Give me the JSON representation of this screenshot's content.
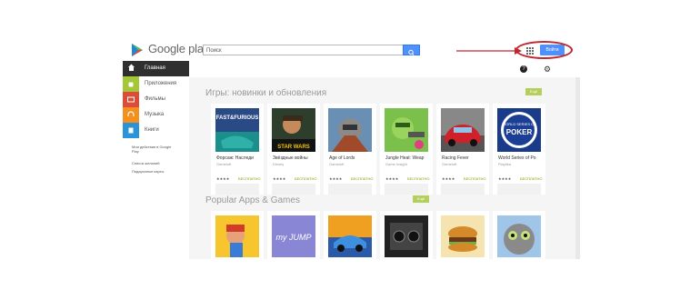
{
  "header": {
    "brand": "Google play",
    "search_placeholder": "Поиск",
    "signin_label": "Войти"
  },
  "sidebar": {
    "items": [
      {
        "label": "Главная",
        "color": "#2f2f2f",
        "icon": "home-icon",
        "active": true
      },
      {
        "label": "Приложения",
        "color": "#a4c739",
        "icon": "android-icon"
      },
      {
        "label": "Фильмы",
        "color": "#dd4b39",
        "icon": "film-icon"
      },
      {
        "label": "Музыка",
        "color": "#f4911e",
        "icon": "headphones-icon"
      },
      {
        "label": "Книги",
        "color": "#2b93d6",
        "icon": "book-icon"
      }
    ],
    "links": [
      "Мои действия в Google Play",
      "Список желаний",
      "Подарочные карты"
    ]
  },
  "sections": [
    {
      "title": "Игры: новинки и обновления",
      "more": "Ещё"
    },
    {
      "title": "Popular Apps & Games",
      "more": "Ещё"
    }
  ],
  "apps_row1": [
    {
      "name": "Форсаж: Наследи",
      "dev": "Gameloft",
      "rating": "★★★★",
      "price": "БЕСПЛАТНО"
    },
    {
      "name": "Звёздные войны",
      "dev": "Disney",
      "rating": "★★★★",
      "price": "БЕСПЛАТНО"
    },
    {
      "name": "Age of Lords",
      "dev": "Gameloft",
      "rating": "★★★★",
      "price": "БЕСПЛАТНО"
    },
    {
      "name": "Jungle Heat: Weap",
      "dev": "Game Insight",
      "rating": "★★★★",
      "price": "БЕСПЛАТНО"
    },
    {
      "name": "Racing Fever",
      "dev": "Gameloft",
      "rating": "★★★★",
      "price": "БЕСПЛАТНО"
    },
    {
      "name": "World Series of Po",
      "dev": "Playtika",
      "rating": "★★★★",
      "price": "БЕСПЛАТНО"
    }
  ],
  "thumb_text": {
    "fast_furious": "FAST&FURIOUS",
    "star_wars": "STAR WARS",
    "poker": "POKER",
    "wsop": "WORLD SERIES OF",
    "jump": "my JUMP"
  },
  "icons": [
    "google-play-logo-icon",
    "search-icon",
    "apps-grid-icon",
    "help-icon",
    "gear-icon"
  ],
  "colors": {
    "accent_blue": "#4d90fe",
    "more_green": "#b4cf5c",
    "annotation_red": "#c0282d"
  }
}
